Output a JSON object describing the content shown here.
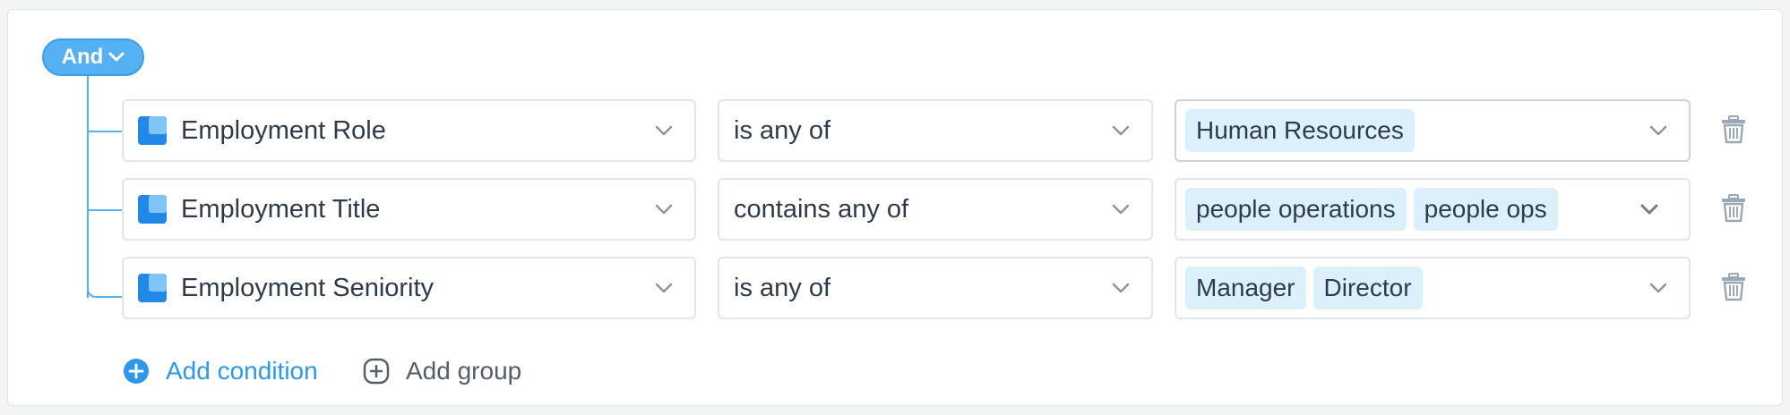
{
  "group": {
    "operator": "And"
  },
  "conditions": [
    {
      "attribute": "Employment Role",
      "operator": "is any of",
      "values": [
        "Human Resources"
      ]
    },
    {
      "attribute": "Employment Title",
      "operator": "contains any of",
      "values": [
        "people operations",
        "people ops"
      ]
    },
    {
      "attribute": "Employment Seniority",
      "operator": "is any of",
      "values": [
        "Manager",
        "Director"
      ]
    }
  ],
  "actions": {
    "add_condition": "Add condition",
    "add_group": "Add group"
  },
  "colors": {
    "accent": "#55b1f3",
    "link": "#2e97ea",
    "tag_bg": "#dcf0fb",
    "icon_dark": "#2288e8",
    "icon_light": "#7fc5f7"
  },
  "icons": {
    "attribute": "database-icon",
    "dropdown": "chevron-down-icon",
    "delete": "trash-icon",
    "add_condition": "plus-circle-icon",
    "add_group": "plus-square-icon"
  }
}
